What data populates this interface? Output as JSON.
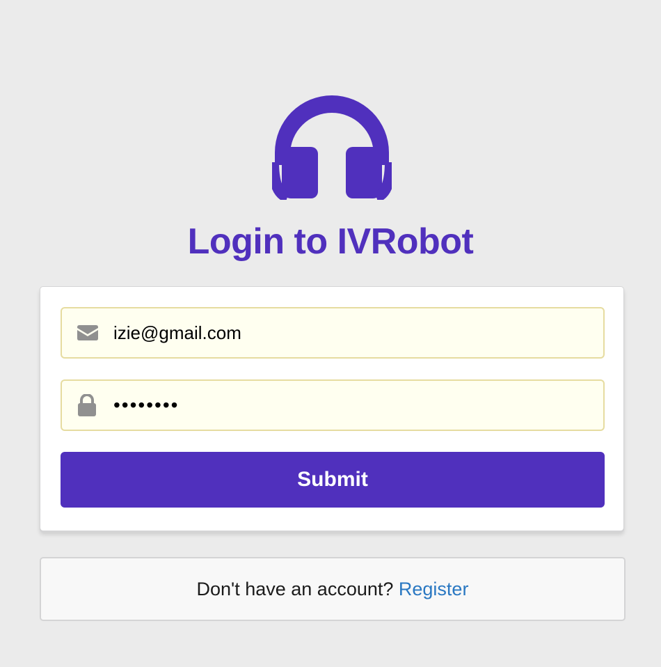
{
  "page": {
    "title": "Login to IVRobot"
  },
  "logo": {
    "icon": "headphones-icon",
    "color": "#5030bd"
  },
  "form": {
    "email": {
      "icon": "envelope-icon",
      "value": "izie@gmail.com"
    },
    "password": {
      "icon": "lock-icon",
      "value": "••••••••"
    },
    "submit_label": "Submit"
  },
  "register": {
    "prompt": "Don't have an account?",
    "link_label": "Register"
  },
  "colors": {
    "primary": "#5030bd",
    "link": "#2a78c2",
    "input_bg": "#fffff0",
    "input_border": "#e6dca0",
    "page_bg": "#ebebeb"
  }
}
